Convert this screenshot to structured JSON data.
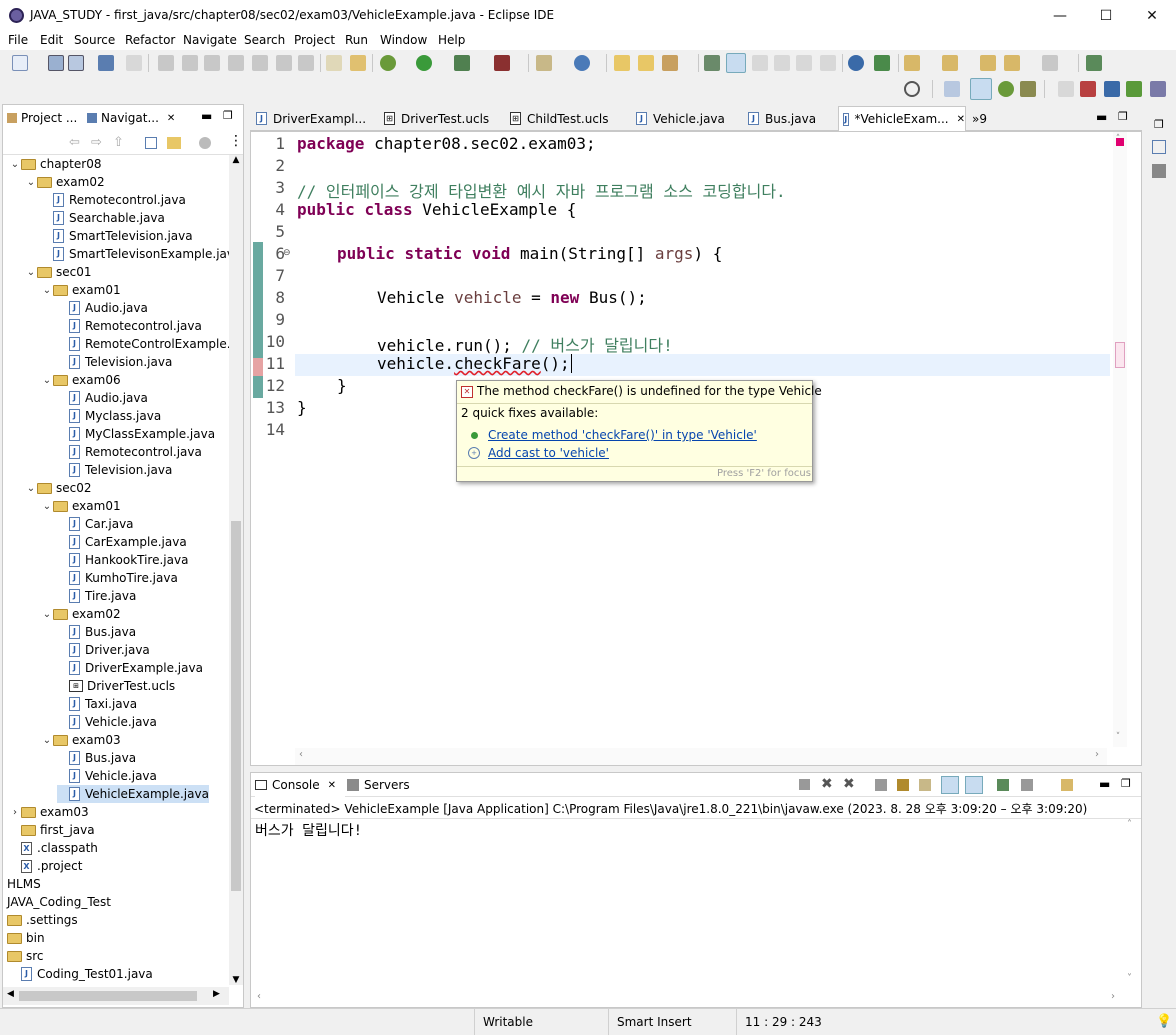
{
  "window": {
    "title": "JAVA_STUDY - first_java/src/chapter08/sec02/exam03/VehicleExample.java - Eclipse IDE",
    "minimize": "—",
    "maximize": "☐",
    "close": "✕"
  },
  "menu": [
    "File",
    "Edit",
    "Source",
    "Refactor",
    "Navigate",
    "Search",
    "Project",
    "Run",
    "Window",
    "Help"
  ],
  "explorer": {
    "tabs": [
      "Project ...",
      "Navigat..."
    ],
    "rows": [
      {
        "label": "chapter08",
        "level": 0,
        "type": "folder",
        "expanded": true
      },
      {
        "label": "exam02",
        "level": 1,
        "type": "folder",
        "expanded": true
      },
      {
        "label": "Remotecontrol.java",
        "level": 2,
        "type": "java"
      },
      {
        "label": "Searchable.java",
        "level": 2,
        "type": "java"
      },
      {
        "label": "SmartTelevision.java",
        "level": 2,
        "type": "java"
      },
      {
        "label": "SmartTelevisonExample.java",
        "level": 2,
        "type": "java"
      },
      {
        "label": "sec01",
        "level": 1,
        "type": "folder",
        "expanded": true
      },
      {
        "label": "exam01",
        "level": 2,
        "type": "folder",
        "expanded": true
      },
      {
        "label": "Audio.java",
        "level": 3,
        "type": "java"
      },
      {
        "label": "Remotecontrol.java",
        "level": 3,
        "type": "java"
      },
      {
        "label": "RemoteControlExample.ja",
        "level": 3,
        "type": "java"
      },
      {
        "label": "Television.java",
        "level": 3,
        "type": "java"
      },
      {
        "label": "exam06",
        "level": 2,
        "type": "folder",
        "expanded": true
      },
      {
        "label": "Audio.java",
        "level": 3,
        "type": "java"
      },
      {
        "label": "Myclass.java",
        "level": 3,
        "type": "java"
      },
      {
        "label": "MyClassExample.java",
        "level": 3,
        "type": "java"
      },
      {
        "label": "Remotecontrol.java",
        "level": 3,
        "type": "java"
      },
      {
        "label": "Television.java",
        "level": 3,
        "type": "java"
      },
      {
        "label": "sec02",
        "level": 1,
        "type": "folder",
        "expanded": true
      },
      {
        "label": "exam01",
        "level": 2,
        "type": "folder",
        "expanded": true
      },
      {
        "label": "Car.java",
        "level": 3,
        "type": "java"
      },
      {
        "label": "CarExample.java",
        "level": 3,
        "type": "java"
      },
      {
        "label": "HankookTire.java",
        "level": 3,
        "type": "java"
      },
      {
        "label": "KumhoTire.java",
        "level": 3,
        "type": "java"
      },
      {
        "label": "Tire.java",
        "level": 3,
        "type": "java"
      },
      {
        "label": "exam02",
        "level": 2,
        "type": "folder",
        "expanded": true
      },
      {
        "label": "Bus.java",
        "level": 3,
        "type": "java"
      },
      {
        "label": "Driver.java",
        "level": 3,
        "type": "java"
      },
      {
        "label": "DriverExample.java",
        "level": 3,
        "type": "java"
      },
      {
        "label": "DriverTest.ucls",
        "level": 3,
        "type": "ucls"
      },
      {
        "label": "Taxi.java",
        "level": 3,
        "type": "java"
      },
      {
        "label": "Vehicle.java",
        "level": 3,
        "type": "java"
      },
      {
        "label": "exam03",
        "level": 2,
        "type": "folder",
        "expanded": true
      },
      {
        "label": "Bus.java",
        "level": 3,
        "type": "java"
      },
      {
        "label": "Vehicle.java",
        "level": 3,
        "type": "java"
      },
      {
        "label": "VehicleExample.java",
        "level": 3,
        "type": "java",
        "selected": true
      },
      {
        "label": "exam03",
        "level": 0,
        "type": "folder",
        "expanded": false
      },
      {
        "label": "first_java",
        "level": 0,
        "type": "folder",
        "expanded": false,
        "notwisty": true
      },
      {
        "label": ".classpath",
        "level": 0,
        "type": "xml"
      },
      {
        "label": ".project",
        "level": 0,
        "type": "xml"
      },
      {
        "label": "HLMS",
        "level": -1,
        "type": "none"
      },
      {
        "label": "JAVA_Coding_Test",
        "level": -1,
        "type": "none"
      },
      {
        "label": ".settings",
        "level": -1,
        "type": "folder"
      },
      {
        "label": "bin",
        "level": -1,
        "type": "folder"
      },
      {
        "label": "src",
        "level": -1,
        "type": "folder"
      },
      {
        "label": "Coding_Test01.java",
        "level": 0,
        "type": "java"
      }
    ]
  },
  "editor": {
    "tabs": [
      {
        "label": "DriverExampl...",
        "type": "java"
      },
      {
        "label": "DriverTest.ucls",
        "type": "ucls"
      },
      {
        "label": "ChildTest.ucls",
        "type": "ucls"
      },
      {
        "label": "Vehicle.java",
        "type": "java"
      },
      {
        "label": "Bus.java",
        "type": "java"
      },
      {
        "label": "*VehicleExam...",
        "type": "java",
        "active": true
      }
    ],
    "overflow": "»9",
    "lines": [
      "1",
      "2",
      "3",
      "4",
      "5",
      "6",
      "7",
      "8",
      "9",
      "10",
      "11",
      "12",
      "13",
      "14"
    ],
    "code": {
      "l1_kw": "package",
      "l1_rest": " chapter08.sec02.exam03;",
      "l3_comment": "// 인터페이스 강제 타입변환 예시 자바 프로그램 소스 코딩합니다.",
      "l4_kw1": "public",
      "l4_kw2": "class",
      "l4_rest": " VehicleExample {",
      "l6_kw1": "public",
      "l6_kw2": "static",
      "l6_kw3": "void",
      "l6_a": " main(String[] ",
      "l6_var": "args",
      "l6_b": ") {",
      "l8_a": "Vehicle ",
      "l8_var": "vehicle",
      "l8_b": " = ",
      "l8_kw": "new",
      "l8_c": " Bus();",
      "l10_a": "vehicle.run(); ",
      "l10_comment": "// 버스가 달립니다!",
      "l11_a": "vehicle.",
      "l11_err": "checkFare",
      "l11_b": "();",
      "l12": "}",
      "l13": "}"
    }
  },
  "tooltip": {
    "message": "The method checkFare() is undefined for the type Vehicle",
    "count": "2 quick fixes available:",
    "fix1": "Create method 'checkFare()' in type 'Vehicle'",
    "fix2": "Add cast to 'vehicle'",
    "hint": "Press 'F2' for focus"
  },
  "console": {
    "tabs": [
      "Console",
      "Servers"
    ],
    "status": "<terminated> VehicleExample [Java Application] C:\\Program Files\\Java\\jre1.8.0_221\\bin\\javaw.exe  (2023. 8. 28 오후 3:09:20 – 오후 3:09:20)",
    "output": "버스가 달립니다!"
  },
  "statusbar": {
    "writable": "Writable",
    "insert": "Smart Insert",
    "position": "11 : 29 : 243"
  }
}
